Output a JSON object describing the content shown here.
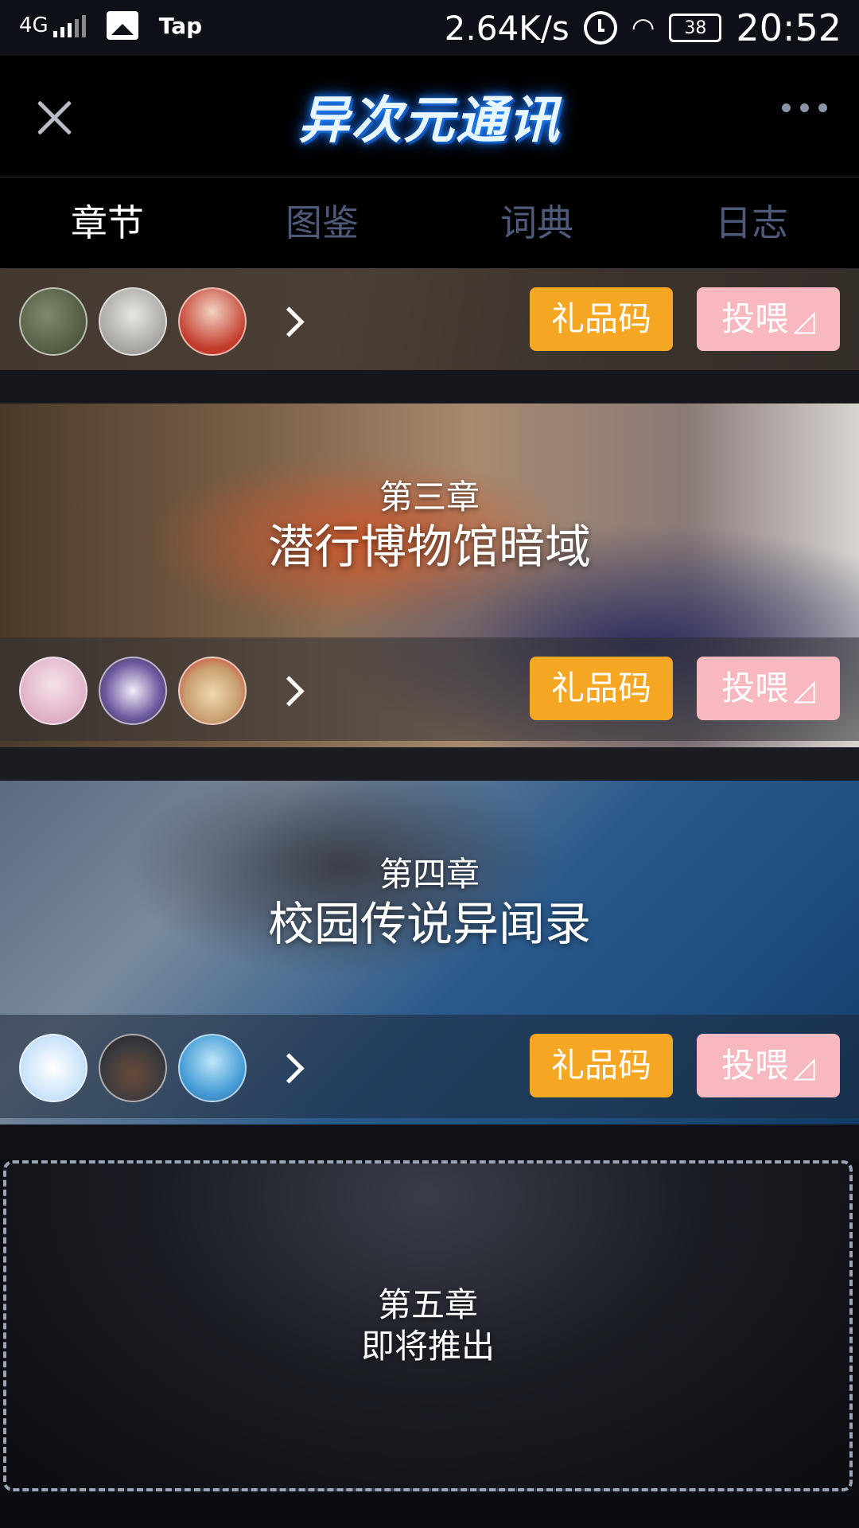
{
  "status_bar": {
    "network": "4G",
    "app_name": "Tap",
    "speed": "2.64K/s",
    "battery": "38",
    "time": "20:52"
  },
  "header": {
    "logo_text": "异次元通讯"
  },
  "tabs": [
    {
      "label": "章节",
      "active": true
    },
    {
      "label": "图鉴",
      "active": false
    },
    {
      "label": "词典",
      "active": false
    },
    {
      "label": "日志",
      "active": false
    }
  ],
  "chapters": [
    {
      "gift_label": "礼品码",
      "feed_label": "投喂"
    },
    {
      "number": "第三章",
      "name": "潜行博物馆暗域",
      "gift_label": "礼品码",
      "feed_label": "投喂"
    },
    {
      "number": "第四章",
      "name": "校园传说异闻录",
      "gift_label": "礼品码",
      "feed_label": "投喂"
    }
  ],
  "coming_soon": {
    "number": "第五章",
    "status": "即将推出"
  },
  "colors": {
    "gift_button": "#f5a623",
    "feed_button": "#f8b8c0",
    "tab_active": "#ffffff",
    "tab_inactive": "#4e5a7a"
  }
}
